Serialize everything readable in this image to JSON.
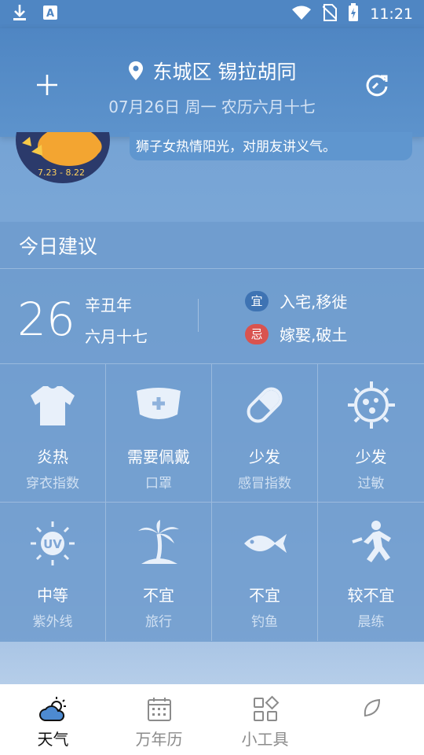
{
  "status_bar": {
    "time": "11:21"
  },
  "header": {
    "location": "东城区 锡拉胡同",
    "date_line": "07月26日 周一 农历六月十七"
  },
  "horoscope": {
    "badge_text": "7.23 - 8.22",
    "text": "狮子女热情阳光，对朋友讲义气。"
  },
  "advice": {
    "title": "今日建议",
    "day_number": "26",
    "lunar_year": "辛丑年",
    "lunar_date": "六月十七",
    "yi_tag": "宜",
    "yi_text": "入宅,移徙",
    "ji_tag": "忌",
    "ji_text": "嫁娶,破土",
    "items": [
      {
        "icon": "shirt-icon",
        "value": "炎热",
        "label": "穿衣指数"
      },
      {
        "icon": "mask-icon",
        "value": "需要佩戴",
        "label": "口罩"
      },
      {
        "icon": "pill-icon",
        "value": "少发",
        "label": "感冒指数"
      },
      {
        "icon": "pollen-icon",
        "value": "少发",
        "label": "过敏"
      },
      {
        "icon": "uv-icon",
        "value": "中等",
        "label": "紫外线"
      },
      {
        "icon": "palm-tree-icon",
        "value": "不宜",
        "label": "旅行"
      },
      {
        "icon": "fish-icon",
        "value": "不宜",
        "label": "钓鱼"
      },
      {
        "icon": "runner-icon",
        "value": "较不宜",
        "label": "晨练"
      }
    ]
  },
  "nav": [
    {
      "label": "天气",
      "active": true
    },
    {
      "label": "万年历",
      "active": false
    },
    {
      "label": "小工具",
      "active": false
    },
    {
      "label": "",
      "active": false
    }
  ],
  "colors": {
    "header_bg": "#4f86c3",
    "panel_bg": "#6e9bcd",
    "yi_tag": "#3e73b3",
    "ji_tag": "#d9534f"
  }
}
